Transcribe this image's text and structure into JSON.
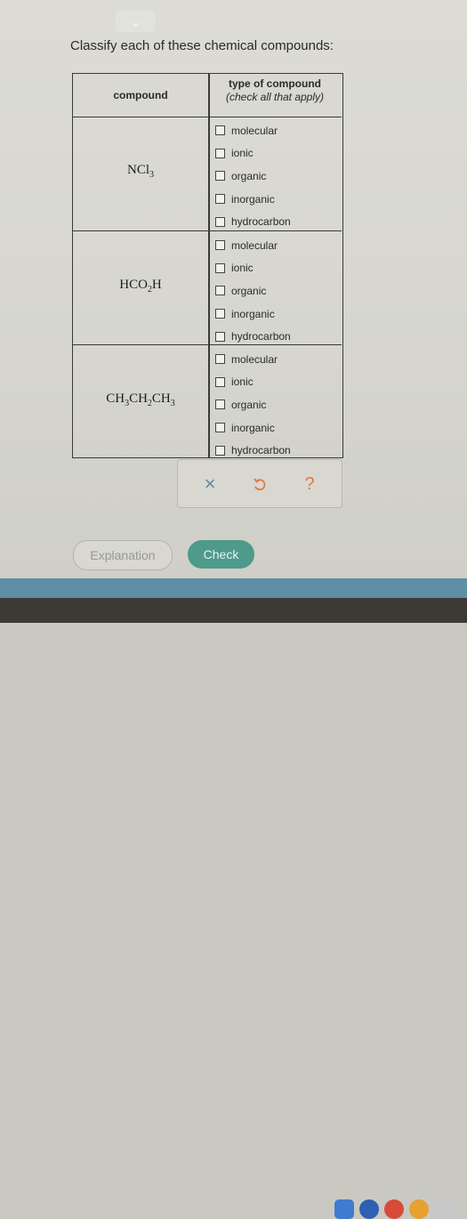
{
  "prompt": "Classify each of these chemical compounds:",
  "table": {
    "header_compound": "compound",
    "header_type_line1": "type of compound",
    "header_type_line2": "(check all that apply)"
  },
  "compounds": [
    {
      "parts": [
        "NCl",
        "3",
        ""
      ],
      "options": [
        "molecular",
        "ionic",
        "organic",
        "inorganic",
        "hydrocarbon"
      ]
    },
    {
      "parts": [
        "HCO",
        "2",
        "H"
      ],
      "options": [
        "molecular",
        "ionic",
        "organic",
        "inorganic",
        "hydrocarbon"
      ]
    },
    {
      "parts": [
        "CH",
        "3",
        "CH",
        "2",
        "CH",
        "3"
      ],
      "options": [
        "molecular",
        "ionic",
        "organic",
        "inorganic",
        "hydrocarbon"
      ]
    }
  ],
  "toolbar": {
    "clear_icon": "close-icon",
    "undo_icon": "undo-icon",
    "help_icon": "help-icon",
    "help_glyph": "?",
    "clear_glyph": "×"
  },
  "buttons": {
    "explanation": "Explanation",
    "check": "Check"
  },
  "colors": {
    "accent": "#4e9a8b",
    "help": "#e07a3f",
    "clear": "#5d8aa8"
  }
}
